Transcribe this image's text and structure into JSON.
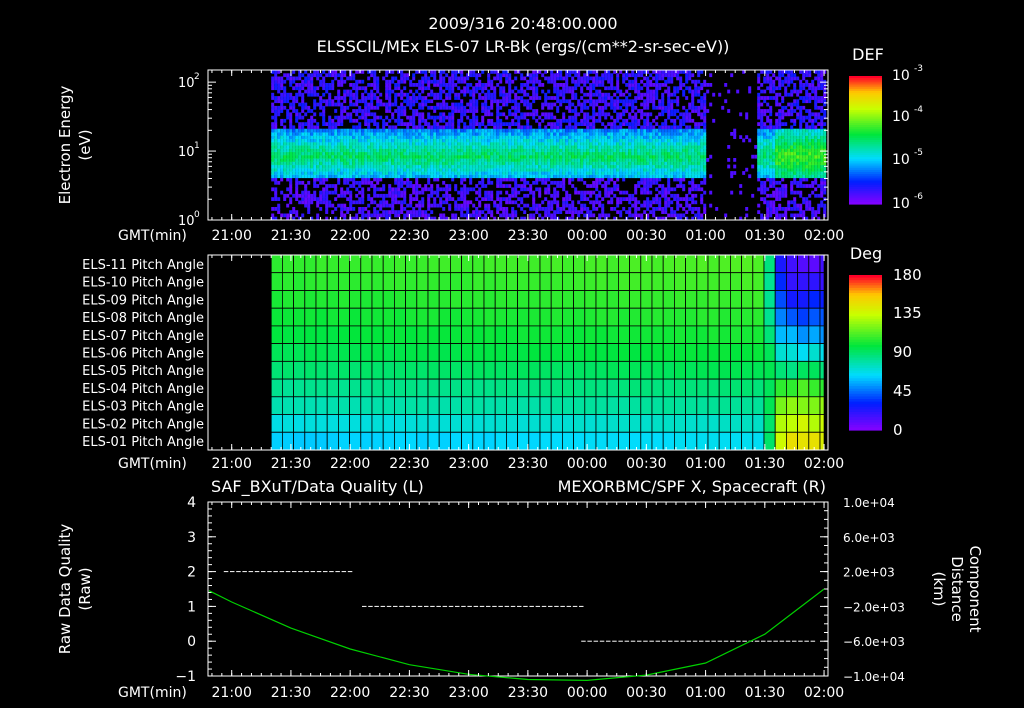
{
  "header": {
    "timestamp": "2009/316 20:48:00.000",
    "title": "ELSSCIL/MEx ELS-07 LR-Bk  (ergs/(cm**2-sr-sec-eV))"
  },
  "time_axis": {
    "label": "GMT(min)",
    "ticks": [
      "21:00",
      "21:30",
      "22:00",
      "22:30",
      "23:00",
      "23:30",
      "00:00",
      "00:30",
      "01:00",
      "01:30",
      "02:00"
    ]
  },
  "colors": {
    "background": "#000000",
    "axis": "#ffffff",
    "line": "#00d000",
    "right_title": "#00d000",
    "quality_dash": "#ffffff"
  },
  "chart_data": [
    {
      "type": "heatmap",
      "name": "spectrogram",
      "ylabel": [
        "Electron Energy",
        "(eV)"
      ],
      "ytick_labels": [
        "10",
        "10",
        "10"
      ],
      "ytick_exponents": [
        "0",
        "1",
        "2"
      ],
      "ylog": true,
      "ylim": [
        1,
        150
      ],
      "colorbar": {
        "label": "DEF",
        "tick_labels": [
          "10",
          "10",
          "10",
          "10"
        ],
        "tick_exponents": [
          "-3",
          "-4",
          "-5",
          "-6"
        ]
      },
      "data_start": "21:20",
      "data_end": "02:00",
      "gap": [
        "01:00",
        "01:25"
      ],
      "band_center_ev": 8,
      "band_low_ev": 4,
      "band_high_ev": 20
    },
    {
      "type": "heatmap",
      "name": "pitch-angles",
      "rows": [
        "ELS-11 Pitch Angle",
        "ELS-10 Pitch Angle",
        "ELS-09 Pitch Angle",
        "ELS-08 Pitch Angle",
        "ELS-07 Pitch Angle",
        "ELS-06 Pitch Angle",
        "ELS-05 Pitch Angle",
        "ELS-04 Pitch Angle",
        "ELS-03 Pitch Angle",
        "ELS-02 Pitch Angle",
        "ELS-01 Pitch Angle"
      ],
      "row_values_deg": [
        108,
        106,
        104,
        101,
        98,
        95,
        90,
        84,
        78,
        70,
        62
      ],
      "late_row_values_deg": [
        15,
        22,
        30,
        40,
        55,
        70,
        90,
        110,
        125,
        135,
        145
      ],
      "colorbar": {
        "label": "Deg",
        "tick_labels": [
          "180",
          "135",
          "90",
          "45",
          "0"
        ],
        "range": [
          0,
          180
        ]
      },
      "data_start": "21:20",
      "data_end": "02:00"
    },
    {
      "type": "line",
      "left_title": "SAF_BXuT/Data Quality (L)",
      "right_title": "MEXORBMC/SPF X, Spacecraft (R)",
      "ylabel_left": [
        "Raw Data Quality",
        "(Raw)"
      ],
      "ylabel_right": [
        "Component",
        "Distance",
        "(km)"
      ],
      "ylim_left": [
        -1,
        4
      ],
      "ytick_labels_left": [
        "4",
        "3",
        "2",
        "1",
        "0",
        "−1"
      ],
      "ylim_right": [
        -10000,
        10000
      ],
      "ytick_labels_right": [
        "1.0e+04",
        "6.0e+03",
        "2.0e+03",
        "−2.0e+03",
        "−6.0e+03",
        "−1.0e+04"
      ],
      "quality_segments": [
        {
          "start": "20:56",
          "end": "22:00",
          "value": 2
        },
        {
          "start": "22:06",
          "end": "23:57",
          "value": 1
        },
        {
          "start": "23:57",
          "end": "01:56",
          "value": 0
        }
      ],
      "spacecraft_x": {
        "x": [
          "20:48",
          "21:00",
          "21:30",
          "22:00",
          "22:30",
          "23:00",
          "23:30",
          "00:00",
          "00:30",
          "01:00",
          "01:30",
          "02:00"
        ],
        "y": [
          -200,
          -1500,
          -4500,
          -6900,
          -8700,
          -9800,
          -10400,
          -10500,
          -9900,
          -8500,
          -5200,
          0
        ]
      }
    }
  ]
}
